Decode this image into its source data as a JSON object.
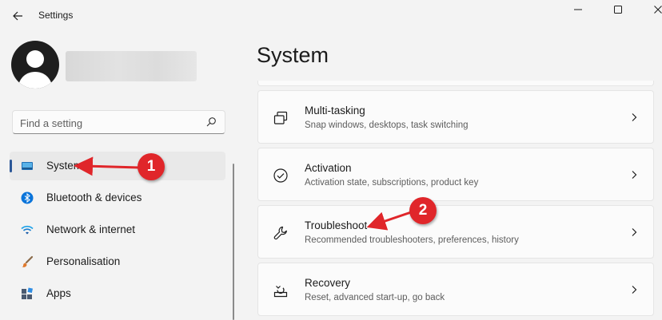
{
  "window": {
    "title": "Settings",
    "controls": [
      "minimize",
      "maximize",
      "close"
    ]
  },
  "search": {
    "placeholder": "Find a setting",
    "value": ""
  },
  "sidebar": {
    "items": [
      {
        "label": "System",
        "icon": "system-icon",
        "active": true
      },
      {
        "label": "Bluetooth & devices",
        "icon": "bluetooth-icon",
        "active": false
      },
      {
        "label": "Network & internet",
        "icon": "wifi-icon",
        "active": false
      },
      {
        "label": "Personalisation",
        "icon": "brush-icon",
        "active": false
      },
      {
        "label": "Apps",
        "icon": "apps-icon",
        "active": false
      }
    ]
  },
  "main": {
    "title": "System",
    "cards": [
      {
        "title": "Multi-tasking",
        "description": "Snap windows, desktops, task switching",
        "icon": "multitasking-icon"
      },
      {
        "title": "Activation",
        "description": "Activation state, subscriptions, product key",
        "icon": "activation-icon"
      },
      {
        "title": "Troubleshoot",
        "description": "Recommended troubleshooters, preferences, history",
        "icon": "wrench-icon"
      },
      {
        "title": "Recovery",
        "description": "Reset, advanced start-up, go back",
        "icon": "recovery-icon"
      }
    ]
  },
  "annotations": {
    "badge_1": "1",
    "badge_2": "2",
    "color": "#e0262a"
  },
  "colors": {
    "accent": "#2b5797",
    "background": "#f3f3f3",
    "card": "#fbfbfb"
  }
}
